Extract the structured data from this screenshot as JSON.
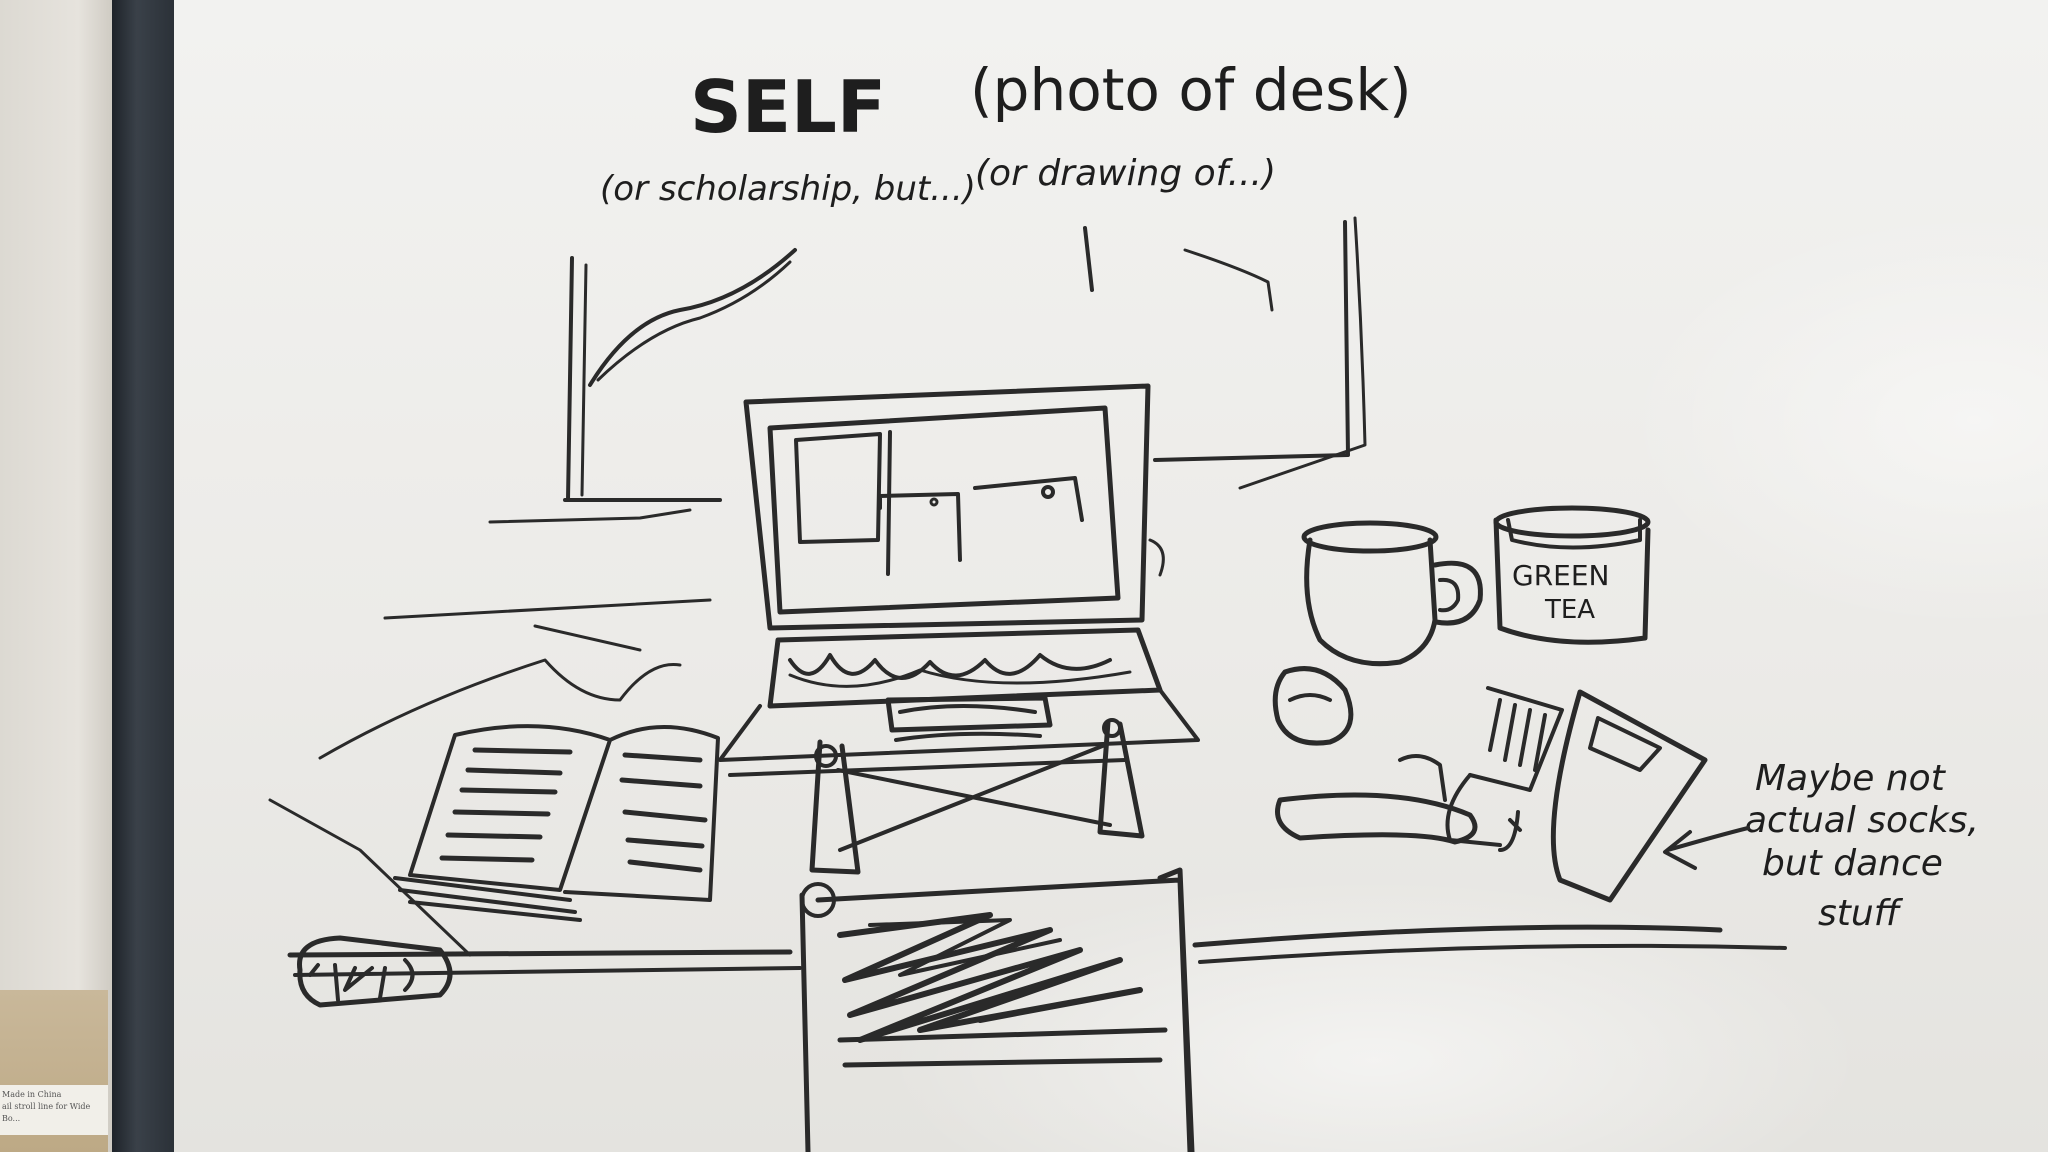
{
  "board": {
    "title": "SELF",
    "title_aside": "(photo of desk)",
    "note_left": "(or scholarship, but...)",
    "note_right": "(or drawing of...)",
    "mug_label_line1": "GREEN",
    "mug_label_line2": "TEA",
    "side_note_lines": [
      "Maybe not",
      "actual socks,",
      "but dance",
      "stuff"
    ]
  },
  "wall_label": {
    "line1": "Made in China",
    "line2": "ail stroll line for Wide Bo..."
  },
  "colors": {
    "ink": "#2a2a2a",
    "board": "#ecebe8",
    "frame": "#2b3138"
  }
}
